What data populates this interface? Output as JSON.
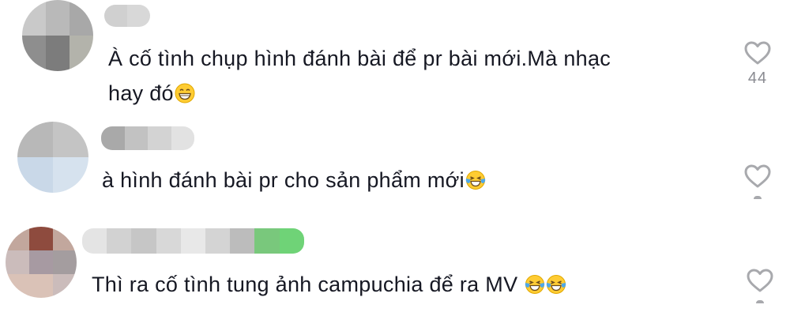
{
  "comments": [
    {
      "text_lines": [
        "À cố tình chụp hình đánh bài để pr bài mới.Mà nhạc",
        "hay đó"
      ],
      "emoji": [
        "grinning-face-emoji"
      ],
      "likes": "44",
      "avatar_colors": [
        "#c9c9c9",
        "#b9b9b9",
        "#a8a8a8",
        "#8e8e8e",
        "#7c7c7c",
        "#b3b3ab"
      ],
      "name_colors": [
        "#d0d0d0",
        "#d8d8d8"
      ]
    },
    {
      "text_lines": [
        "à hình đánh bài pr cho sản phẩm mới"
      ],
      "emoji": [
        "tears-of-joy-emoji"
      ],
      "likes": "",
      "avatar_colors": [
        "#b8b8b8",
        "#c4c4c4",
        "#c9d8e8",
        "#d6e2ee"
      ],
      "name_colors": [
        "#a9a9a9",
        "#c2c2c2",
        "#d3d3d3",
        "#e2e2e2"
      ]
    },
    {
      "text_lines": [
        "Thì ra cố tình tung ảnh campuchia để ra MV"
      ],
      "emoji": [
        "tears-of-joy-emoji",
        "tears-of-joy-emoji"
      ],
      "likes": "",
      "avatar_colors": [
        "#c2a79d",
        "#8e4b3e",
        "#cbbcbb",
        "#a79aa2",
        "#a49d9f",
        "#dac2b7"
      ],
      "name_colors": [
        "#e4e4e4",
        "#d2d2d2",
        "#c6c6c6",
        "#d8d8d8",
        "#e8e8e8",
        "#d4d4d4",
        "#bcbcbc",
        "#79c87c",
        "#6fd377"
      ]
    }
  ],
  "colors": {
    "text": "#161823",
    "like_icon": "#a8a9ad",
    "like_count": "#8a8b91"
  }
}
